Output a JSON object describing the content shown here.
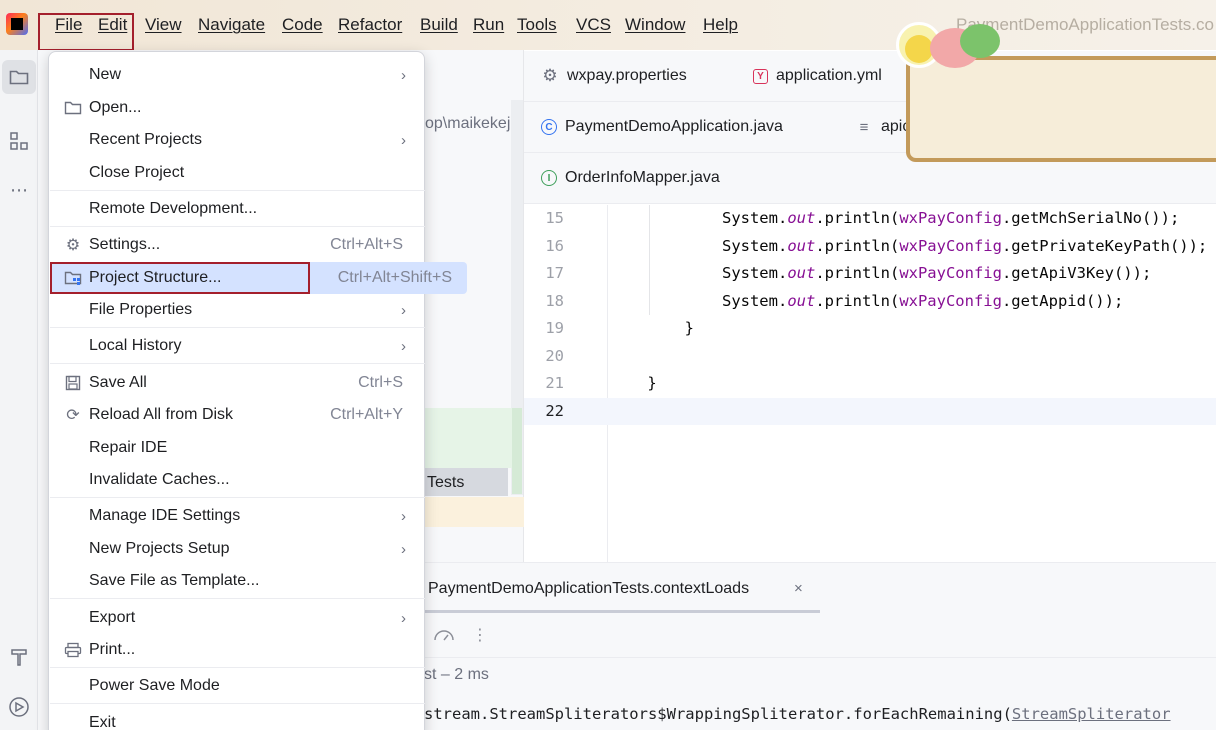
{
  "menubar": {
    "items": [
      {
        "label": "File"
      },
      {
        "label": "Edit"
      },
      {
        "label": "View"
      },
      {
        "label": "Navigate"
      },
      {
        "label": "Code"
      },
      {
        "label": "Refactor"
      },
      {
        "label": "Build"
      },
      {
        "label": "Run"
      },
      {
        "label": "Tools"
      },
      {
        "label": "VCS"
      },
      {
        "label": "Window"
      },
      {
        "label": "Help"
      }
    ],
    "window_title": "PaymentDemoApplicationTests.co"
  },
  "toolstrip": {
    "top": [
      "folder-icon",
      "structure-icon",
      "more-icon"
    ],
    "bottom": [
      "build-hammer-icon",
      "services-icon"
    ]
  },
  "project_pane": {
    "path_fragment": "op\\maikekeji\\",
    "selected_row_label": "Tests"
  },
  "editor": {
    "tab_rows": [
      [
        {
          "icon": "gear-icon",
          "label": "wxpay.properties"
        },
        {
          "icon": "yaml-icon",
          "label": "application.yml"
        }
      ],
      [
        {
          "icon": "spring-class-icon",
          "label": "PaymentDemoApplication.java"
        },
        {
          "icon": "text-file-icon",
          "label": "apic"
        }
      ],
      [
        {
          "icon": "interface-icon",
          "label": "OrderInfoMapper.java"
        }
      ]
    ],
    "lines": [
      {
        "num": "15",
        "pre": "            System.",
        "fld": "out",
        "mid": ".println(",
        "var": "wxPayConfig",
        "post": ".getMchSerialNo());"
      },
      {
        "num": "16",
        "pre": "            System.",
        "fld": "out",
        "mid": ".println(",
        "var": "wxPayConfig",
        "post": ".getPrivateKeyPath());"
      },
      {
        "num": "17",
        "pre": "            System.",
        "fld": "out",
        "mid": ".println(",
        "var": "wxPayConfig",
        "post": ".getApiV3Key());"
      },
      {
        "num": "18",
        "pre": "            System.",
        "fld": "out",
        "mid": ".println(",
        "var": "wxPayConfig",
        "post": ".getAppid());"
      },
      {
        "num": "19",
        "pre": "        }",
        "fld": "",
        "mid": "",
        "var": "",
        "post": ""
      },
      {
        "num": "20",
        "pre": "",
        "fld": "",
        "mid": "",
        "var": "",
        "post": ""
      },
      {
        "num": "21",
        "pre": "    }",
        "fld": "",
        "mid": "",
        "var": "",
        "post": ""
      },
      {
        "num": "22",
        "pre": "",
        "fld": "",
        "mid": "",
        "var": "",
        "post": ""
      }
    ]
  },
  "run_panel": {
    "tab_label": "PaymentDemoApplicationTests.contextLoads",
    "close_glyph": "×",
    "status": "st – 2 ms",
    "console_text": "stream.StreamSpliterators$WrappingSpliterator.forEachRemaining(",
    "console_link": "StreamSpliterator"
  },
  "file_menu": {
    "items": [
      {
        "label": "New",
        "submenu": true
      },
      {
        "label": "Open...",
        "icon": "folder-icon"
      },
      {
        "label": "Recent Projects",
        "submenu": true
      },
      {
        "label": "Close Project"
      },
      {
        "label": "Remote Development..."
      },
      {
        "label": "Settings...",
        "icon": "gear-icon",
        "shortcut": "Ctrl+Alt+S"
      },
      {
        "label": "Project Structure...",
        "icon": "project-structure-icon",
        "shortcut": "Ctrl+Alt+Shift+S",
        "hover": true
      },
      {
        "label": "File Properties",
        "submenu": true
      },
      {
        "label": "Local History",
        "submenu": true
      },
      {
        "label": "Save All",
        "icon": "save-icon",
        "shortcut": "Ctrl+S"
      },
      {
        "label": "Reload All from Disk",
        "icon": "reload-icon",
        "shortcut": "Ctrl+Alt+Y"
      },
      {
        "label": "Repair IDE"
      },
      {
        "label": "Invalidate Caches..."
      },
      {
        "label": "Manage IDE Settings",
        "submenu": true
      },
      {
        "label": "New Projects Setup",
        "submenu": true
      },
      {
        "label": "Save File as Template..."
      },
      {
        "label": "Export",
        "submenu": true
      },
      {
        "label": "Print...",
        "icon": "print-icon"
      },
      {
        "label": "Power Save Mode"
      },
      {
        "label": "Exit"
      }
    ],
    "submenu_glyph": "›"
  },
  "colors": {
    "highlight_box": "#a41f2c",
    "hover_row": "#d4e2ff"
  }
}
